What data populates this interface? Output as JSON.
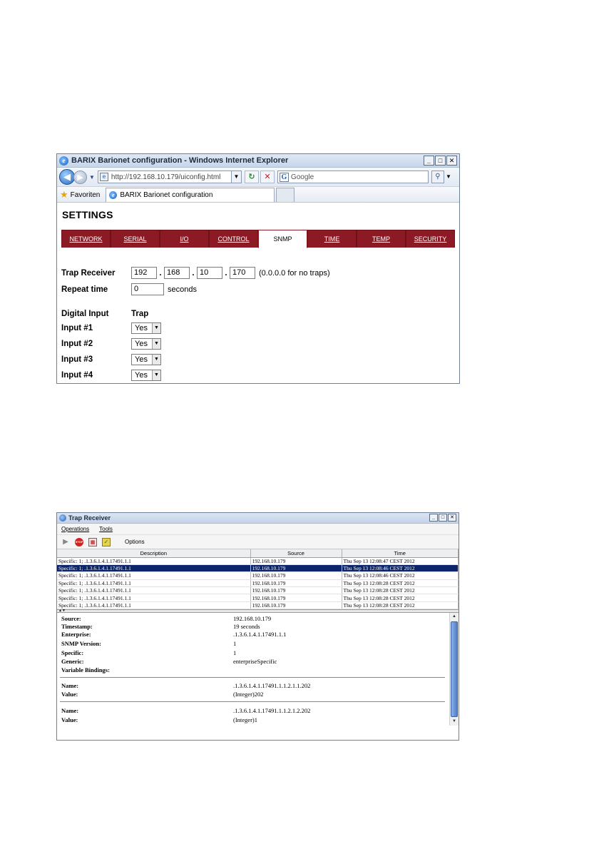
{
  "ie": {
    "title": "BARIX Barionet configuration - Windows Internet Explorer",
    "address": "http://192.168.10.179/uiconfig.html",
    "search_placeholder": "Google",
    "favorites_label": "Favoriten",
    "tab_title": "BARIX Barionet configuration",
    "page": {
      "heading": "SETTINGS",
      "tabs": [
        "NETWORK",
        "SERIAL",
        "I/O",
        "CONTROL",
        "SNMP",
        "TIME",
        "TEMP",
        "SECURITY"
      ],
      "active_tab": "SNMP",
      "trap_receiver_label": "Trap Receiver",
      "trap_ip": [
        "192",
        "168",
        "10",
        "170"
      ],
      "trap_hint": "(0.0.0.0 for no traps)",
      "repeat_label": "Repeat time",
      "repeat_value": "0",
      "repeat_unit": "seconds",
      "digital_input_header": "Digital Input",
      "trap_header": "Trap",
      "inputs": [
        {
          "label": "Input #1",
          "value": "Yes"
        },
        {
          "label": "Input #2",
          "value": "Yes"
        },
        {
          "label": "Input #3",
          "value": "Yes"
        },
        {
          "label": "Input #4",
          "value": "Yes"
        }
      ]
    }
  },
  "trap": {
    "title": "Trap Receiver",
    "menu": [
      "Operations",
      "Tools"
    ],
    "toolbar_options": "Options",
    "columns": [
      "Description",
      "Source",
      "Time"
    ],
    "rows": [
      [
        "Specific: 1; .1.3.6.1.4.1.17491.1.1",
        "192.168.10.179",
        "Thu Sep 13 12:08:47 CEST 2012"
      ],
      [
        "Specific: 1; .1.3.6.1.4.1.17491.1.1",
        "192.168.10.179",
        "Thu Sep 13 12:08:46 CEST 2012"
      ],
      [
        "Specific: 1; .1.3.6.1.4.1.17491.1.1",
        "192.168.10.179",
        "Thu Sep 13 12:08:46 CEST 2012"
      ],
      [
        "Specific: 1; .1.3.6.1.4.1.17491.1.1",
        "192.168.10.179",
        "Thu Sep 13 12:08:28 CEST 2012"
      ],
      [
        "Specific: 1; .1.3.6.1.4.1.17491.1.1",
        "192.168.10.179",
        "Thu Sep 13 12:08:28 CEST 2012"
      ],
      [
        "Specific: 1; .1.3.6.1.4.1.17491.1.1",
        "192.168.10.179",
        "Thu Sep 13 12:08:28 CEST 2012"
      ],
      [
        "Specific: 1; .1.3.6.1.4.1.17491.1.1",
        "192.168.10.179",
        "Thu Sep 13 12:08:28 CEST 2012"
      ]
    ],
    "selected_row": 1,
    "details": [
      {
        "k": "Source:",
        "v": "192.168.10.179"
      },
      {
        "k": "Timestamp:",
        "v": "19 seconds"
      },
      {
        "k": "Enterprise:",
        "v": ".1.3.6.1.4.1.17491.1.1"
      },
      {
        "k": "SNMP Version:",
        "v": "1"
      },
      {
        "k": "Specific:",
        "v": "1"
      },
      {
        "k": "Generic:",
        "v": "enterpriseSpecific"
      },
      {
        "k": "Variable Bindings:",
        "v": ""
      }
    ],
    "bindings": [
      {
        "name_label": "Name:",
        "name": ".1.3.6.1.4.1.17491.1.1.2.1.1.202",
        "value_label": "Value:",
        "value": "(Integer)202"
      },
      {
        "name_label": "Name:",
        "name": ".1.3.6.1.4.1.17491.1.1.2.1.2.202",
        "value_label": "Value:",
        "value": "(Integer)1"
      }
    ]
  }
}
